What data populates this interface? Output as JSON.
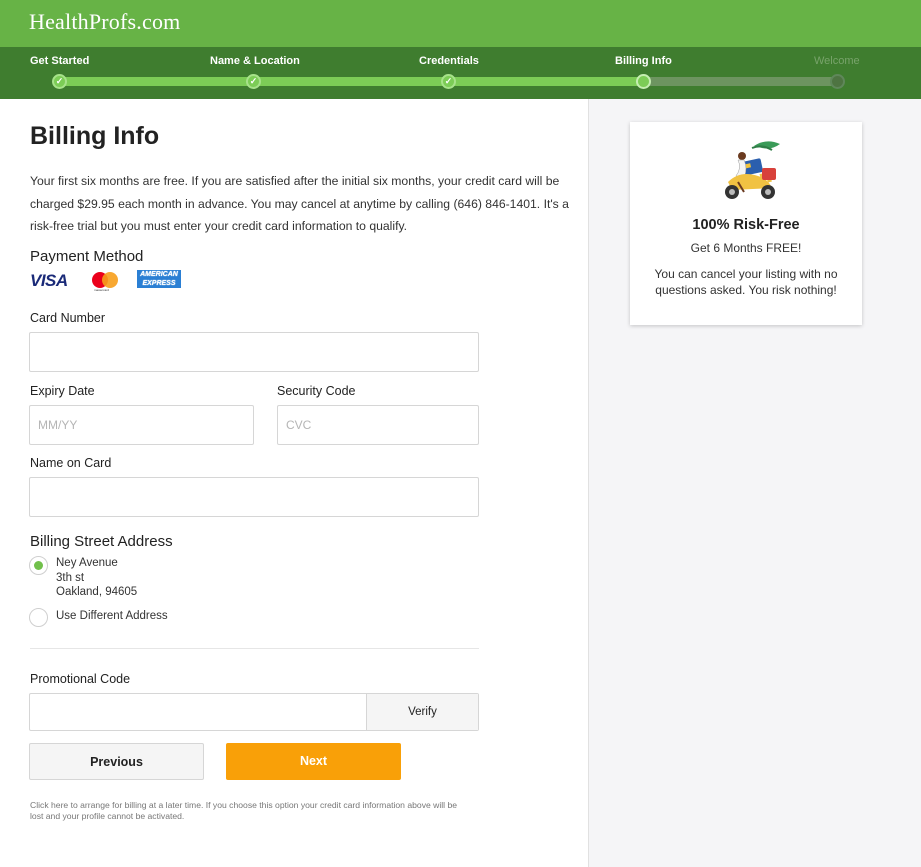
{
  "brand": {
    "logo": "HealthProfs.com"
  },
  "steps": [
    {
      "label": "Get Started",
      "state": "done"
    },
    {
      "label": "Name & Location",
      "state": "done"
    },
    {
      "label": "Credentials",
      "state": "done"
    },
    {
      "label": "Billing Info",
      "state": "current"
    },
    {
      "label": "Welcome",
      "state": "todo"
    }
  ],
  "page": {
    "title": "Billing Info",
    "intro": "Your first six months are free. If you are satisfied after the initial six months, your credit card will be charged $29.95 each month in advance. You may cancel at anytime by calling (646) 846-1401. It's a risk-free trial but you must enter your credit card information to qualify."
  },
  "payment": {
    "heading": "Payment Method",
    "cards": [
      "VISA",
      "mastercard",
      "AMERICAN EXPRESS"
    ]
  },
  "form": {
    "card_number_label": "Card Number",
    "card_number_value": "",
    "expiry_label": "Expiry Date",
    "expiry_placeholder": "MM/YY",
    "security_label": "Security Code",
    "security_placeholder": "CVC",
    "name_label": "Name on Card",
    "name_value": ""
  },
  "billing_address": {
    "heading": "Billing Street Address",
    "options": [
      {
        "line1": "Ney Avenue",
        "line2": "3th st",
        "line3": "Oakland, 94605",
        "selected": true
      },
      {
        "label": "Use Different Address",
        "selected": false
      }
    ]
  },
  "promo": {
    "label": "Promotional Code",
    "value": "",
    "verify_label": "Verify"
  },
  "actions": {
    "previous_label": "Previous",
    "next_label": "Next"
  },
  "footnote": "Click here to arrange for billing at a later time. If you choose this option your credit card information above will be lost and your profile cannot be activated.",
  "sidebar": {
    "title": "100% Risk-Free",
    "subtitle": "Get 6 Months FREE!",
    "body": "You can cancel your listing with no questions asked. You risk nothing!",
    "illustration": "scooter-rider-illustration"
  },
  "colors": {
    "header_green": "#67b346",
    "step_bar_green": "#3f7d2f",
    "progress_green": "#7ccc56",
    "next_button_orange": "#f9a008",
    "radio_selected": "#71c04b"
  }
}
